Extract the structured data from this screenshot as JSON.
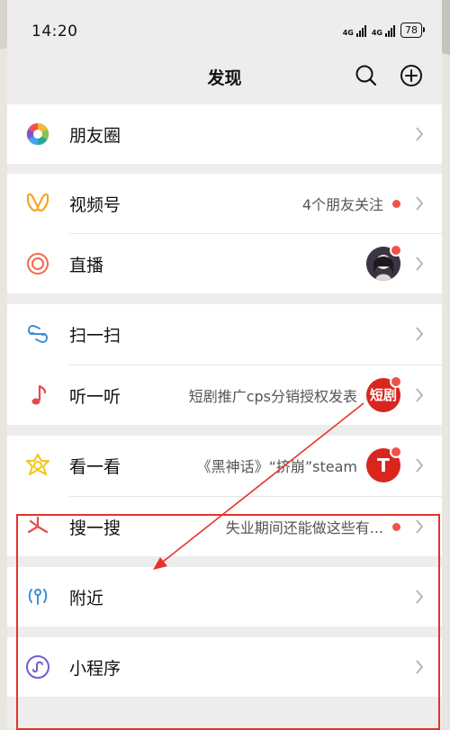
{
  "status_bar": {
    "time": "14:20",
    "signal1": "4G",
    "signal2": "4G",
    "battery": "78"
  },
  "header": {
    "title": "发现",
    "search_icon": "search-icon",
    "add_icon": "plus-circle-icon"
  },
  "items": {
    "moments": {
      "label": "朋友圈",
      "icon": "moments-aperture-icon"
    },
    "channels": {
      "label": "视频号",
      "subtitle": "4个朋友关注",
      "icon": "channels-icon"
    },
    "live": {
      "label": "直播",
      "icon": "live-icon"
    },
    "scan": {
      "label": "扫一扫",
      "icon": "scan-icon"
    },
    "listen": {
      "label": "听一听",
      "subtitle": "短剧推广cps分销授权发表",
      "icon": "music-note-icon",
      "thumb_text": "短剧"
    },
    "topstories": {
      "label": "看一看",
      "subtitle": "《黑神话》“挤崩”steam",
      "icon": "top-stories-icon",
      "thumb_text": "T"
    },
    "search": {
      "label": "搜一搜",
      "subtitle": "失业期间还能做这些有...",
      "icon": "search-spark-icon"
    },
    "nearby": {
      "label": "附近",
      "icon": "nearby-icon"
    },
    "miniprogram": {
      "label": "小程序",
      "icon": "mini-program-icon"
    }
  },
  "colors": {
    "accent_red": "#f0514b",
    "annotation_red": "#e5332a",
    "background": "#ededed"
  }
}
